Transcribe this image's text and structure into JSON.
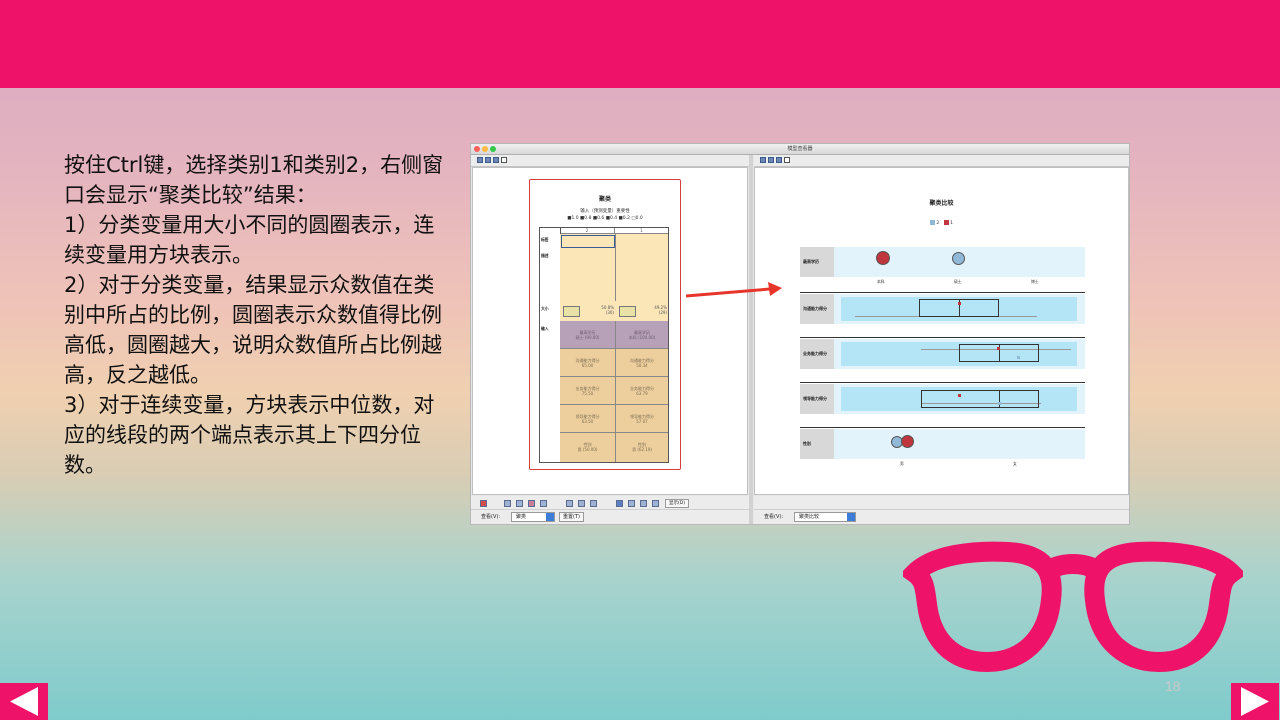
{
  "slide": {
    "paragraphs": [
      "按住Ctrl键，选择类别1和类别2，右侧窗口会显示“聚类比较”结果：",
      "1）分类变量用大小不同的圆圈表示，连续变量用方块表示。",
      "2）对于分类变量，结果显示众数值在类别中所占的比例，圆圈表示众数值得比例高低，圆圈越大，说明众数值所占比例越高，反之越低。",
      "3）对于连续变量，方块表示中位数，对应的线段的两个端点表示其上下四分位数。"
    ],
    "page_number": "18",
    "accent_color": "#ee1269"
  },
  "window": {
    "title": "模型查看器",
    "left_pane": {
      "title": "聚类",
      "subtitle": "输入（预测变量）重要性",
      "importance_legend": "■1.0 ■0.8 ■0.6 ■0.4 ■0.2 □0.0",
      "columns": [
        "2",
        "1"
      ],
      "row_labels": [
        "标签",
        "描述",
        "大小",
        "输入"
      ],
      "sizes": [
        "50.8%\n(30)",
        "49.2%\n(29)"
      ],
      "inputs": [
        [
          "最高学历\n硕士 (90.00)",
          "最高学历\n本科 (100.00)"
        ],
        [
          "沟通能力得分\n65.00",
          "沟通能力得分\n50.34"
        ],
        [
          "业务能力得分\n75.50",
          "业务能力得分\n63.79"
        ],
        [
          "领导能力得分\n63.50",
          "领导能力得分\n57.07"
        ],
        [
          "性别\n男 (50.00)",
          "性别\n男 (62.19)"
        ]
      ],
      "bottom_show_button": "显示(D)",
      "view_label": "查看(V):",
      "view_value": "聚类",
      "reset_button": "重置(T)"
    },
    "right_pane": {
      "title": "聚类比较",
      "legend": [
        "2",
        "1"
      ],
      "legend_colors": [
        "#8fb9d6",
        "#c0363f"
      ],
      "rows": [
        "最高学历",
        "沟通能力得分",
        "业务能力得分",
        "领导能力得分",
        "性别"
      ],
      "education_ticks": [
        "本科",
        "硕士",
        "博士"
      ],
      "gender_ticks": [
        "男",
        "女"
      ],
      "view_label": "查看(V):",
      "view_value": "聚类比较"
    }
  }
}
